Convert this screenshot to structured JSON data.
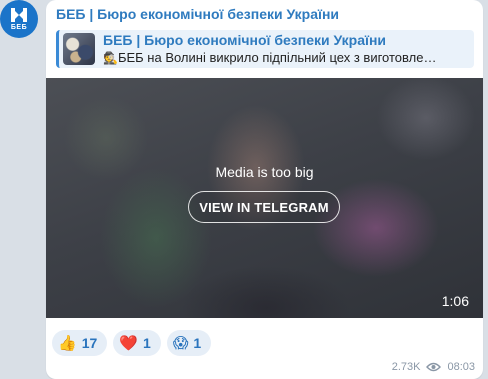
{
  "channel": {
    "avatar_text": "БЕБ",
    "name": "БЕБ | Бюро економічної безпеки України"
  },
  "reply": {
    "title": "БЕБ | Бюро економічної безпеки України",
    "emoji": "🕵️",
    "text": "БЕБ на Волині викрило підпільний цех з виготовле…"
  },
  "media": {
    "notice": "Media is too big",
    "button_label": "VIEW IN TELEGRAM",
    "duration": "1:06"
  },
  "reactions": [
    {
      "emoji": "👍",
      "count": "17"
    },
    {
      "emoji": "❤️",
      "count": "1"
    },
    {
      "emoji": "😱",
      "count": "1"
    }
  ],
  "footer": {
    "views": "2.73K",
    "time": "08:03"
  },
  "colors": {
    "accent": "#2f7bbf",
    "avatar_bg": "#1b74c9",
    "reaction_bg": "#e6eef7"
  }
}
